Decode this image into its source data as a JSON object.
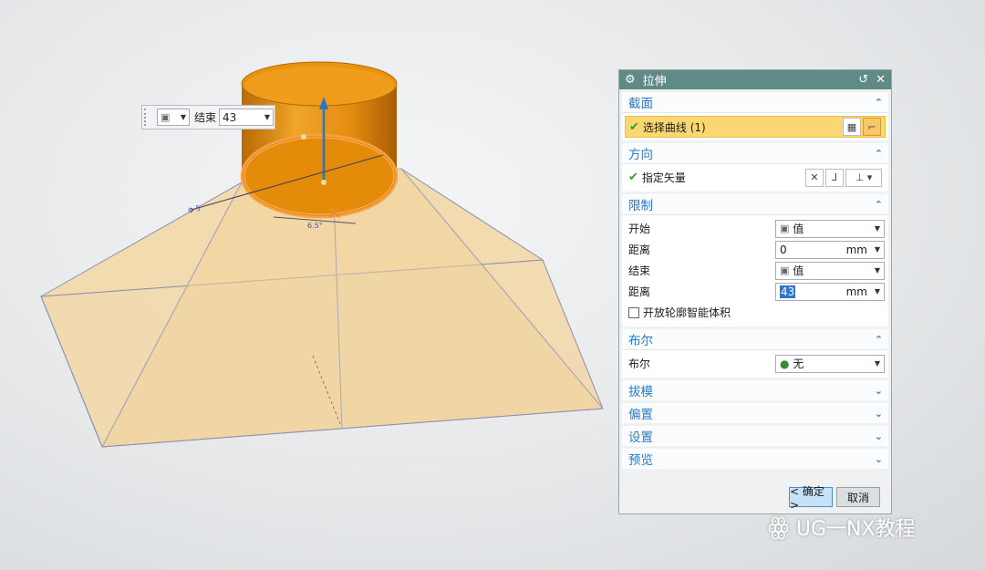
{
  "float_input": {
    "label": "结束",
    "value": "43"
  },
  "dimensions": {
    "diameter_label": "Φ 5",
    "offset_label": "6.5°"
  },
  "dialog": {
    "title": "拉伸",
    "sections": {
      "section": {
        "title": "截面",
        "select_curve": "选择曲线 (1)"
      },
      "direction": {
        "title": "方向",
        "specify_vector": "指定矢量"
      },
      "limits": {
        "title": "限制",
        "start_label": "开始",
        "start_value": "值",
        "start_distance_label": "距离",
        "start_distance": "0",
        "start_unit": "mm",
        "end_label": "结束",
        "end_value": "值",
        "end_distance_label": "距离",
        "end_distance": "43",
        "end_unit": "mm",
        "open_profile": "开放轮廓智能体积"
      },
      "boolean": {
        "title": "布尔",
        "label": "布尔",
        "value": "无"
      },
      "draft": {
        "title": "拔模"
      },
      "offset": {
        "title": "偏置"
      },
      "settings": {
        "title": "设置"
      },
      "preview": {
        "title": "预览"
      }
    },
    "ok_label": "< 确定 >",
    "cancel_label": "取消"
  },
  "watermark": "UG一NX教程",
  "colors": {
    "titlebar": "#5f8a86",
    "section_head": "#2a7bc8",
    "highlight": "#fbd774",
    "cylinder": "#e8900f"
  },
  "icons": [
    "gear-icon",
    "reset-icon",
    "close-icon",
    "check-icon",
    "cube-icon",
    "chevron-up-icon",
    "chevron-down-icon"
  ]
}
